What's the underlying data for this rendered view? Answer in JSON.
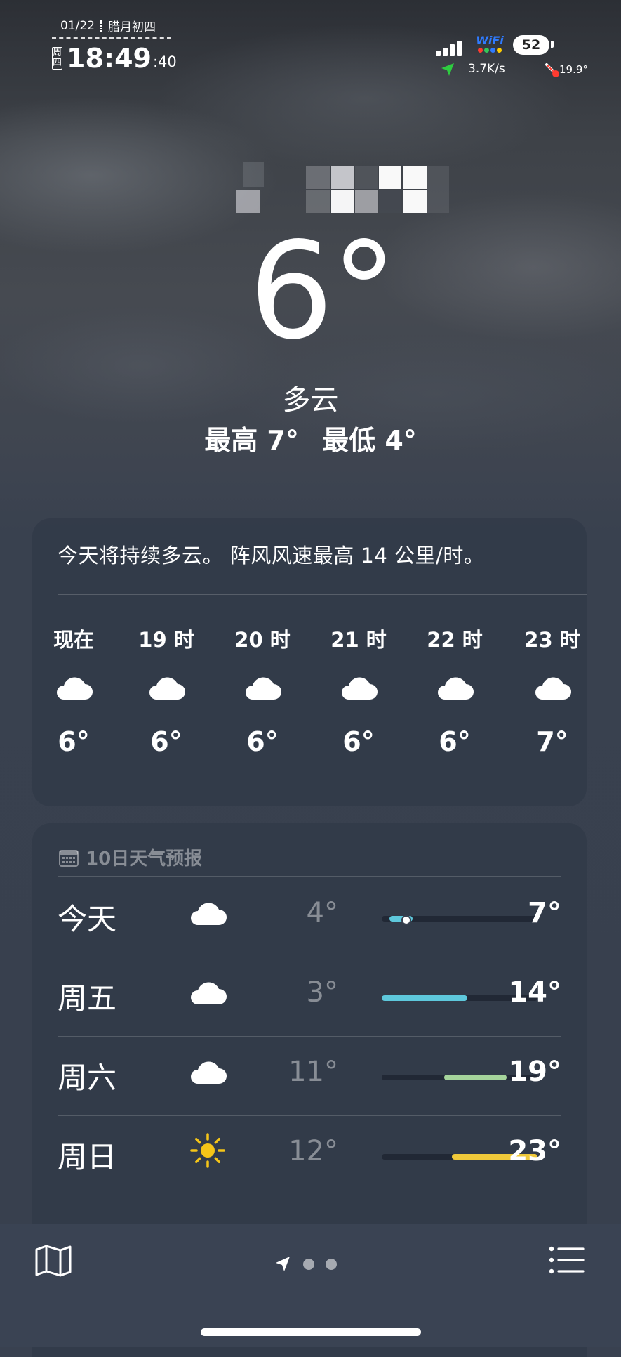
{
  "status_bar": {
    "date": "01/22",
    "lunar_date": "腊月初四",
    "weekday": "周四",
    "time": "18:49",
    "seconds": ":40",
    "wifi_label": "WiFi",
    "battery": "52",
    "net_speed": "3.7K/s",
    "device_temp": "19.9°"
  },
  "current": {
    "temperature": "6°",
    "condition": "多云",
    "high": "最高 7°",
    "low": "最低 4°"
  },
  "hourly": {
    "summary": "今天将持续多云。 阵风风速最高 14 公里/时。",
    "items": [
      {
        "label": "现在",
        "icon": "cloud-icon",
        "temp": "6°"
      },
      {
        "label": "19 时",
        "icon": "cloud-icon",
        "temp": "6°"
      },
      {
        "label": "20 时",
        "icon": "cloud-icon",
        "temp": "6°"
      },
      {
        "label": "21 时",
        "icon": "cloud-icon",
        "temp": "6°"
      },
      {
        "label": "22 时",
        "icon": "cloud-icon",
        "temp": "6°"
      },
      {
        "label": "23 时",
        "icon": "cloud-icon",
        "temp": "7°"
      }
    ]
  },
  "daily": {
    "title": "10日天气预报",
    "range_min": 3,
    "range_max": 23,
    "days": [
      {
        "day": "今天",
        "icon": "cloud-icon",
        "low": "4°",
        "high": "7°",
        "low_value": 4,
        "high_value": 7,
        "current_value": 6,
        "color": "#5ec8dc"
      },
      {
        "day": "周五",
        "icon": "cloud-icon",
        "low": "3°",
        "high": "14°",
        "low_value": 3,
        "high_value": 14,
        "color": "#5ec8dc"
      },
      {
        "day": "周六",
        "icon": "cloud-icon",
        "low": "11°",
        "high": "19°",
        "low_value": 11,
        "high_value": 19,
        "color": "#a5d49b"
      },
      {
        "day": "周日",
        "icon": "sun-icon",
        "low": "12°",
        "high": "23°",
        "low_value": 12,
        "high_value": 23,
        "color": "#f0c93a"
      }
    ]
  },
  "colors": {
    "card_bg": "#2e3645",
    "sun": "#f5c518",
    "accent_blue": "#2f7bff"
  }
}
